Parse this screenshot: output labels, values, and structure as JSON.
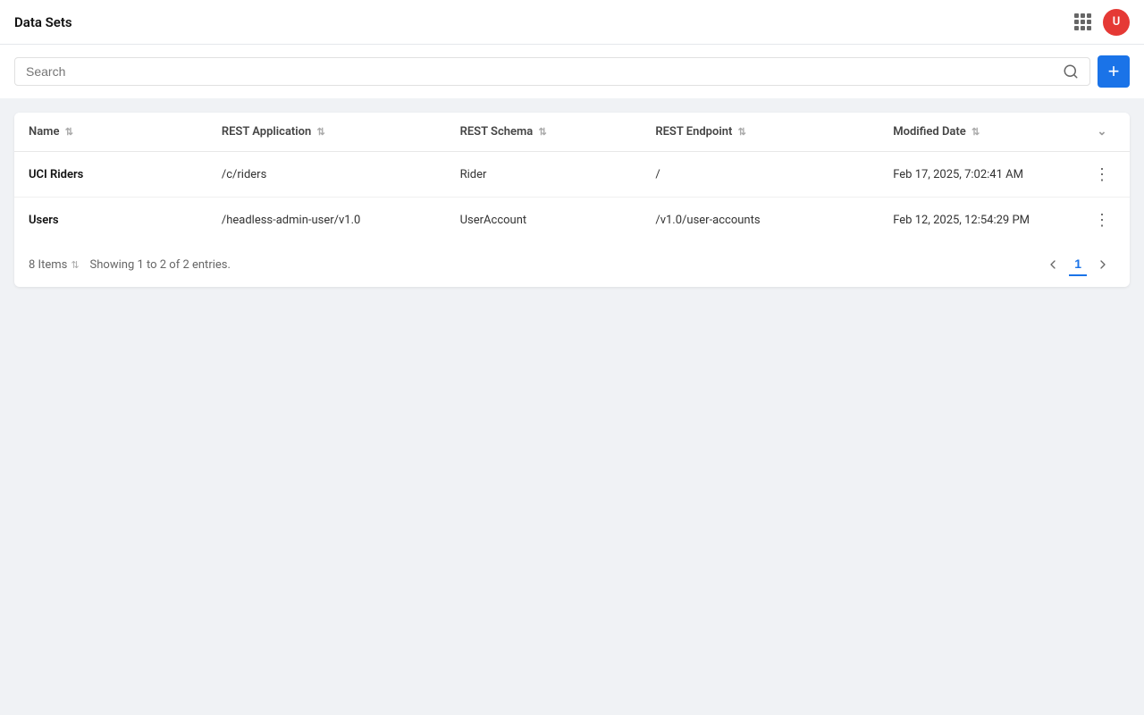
{
  "topBar": {
    "title": "Data Sets",
    "gridIconLabel": "apps-grid",
    "avatarInitial": "U"
  },
  "search": {
    "placeholder": "Search"
  },
  "addButton": {
    "label": "+"
  },
  "table": {
    "columns": [
      {
        "id": "name",
        "label": "Name"
      },
      {
        "id": "rest_application",
        "label": "REST Application"
      },
      {
        "id": "rest_schema",
        "label": "REST Schema"
      },
      {
        "id": "rest_endpoint",
        "label": "REST Endpoint"
      },
      {
        "id": "modified_date",
        "label": "Modified Date"
      }
    ],
    "rows": [
      {
        "name": "UCI Riders",
        "rest_application": "/c/riders",
        "rest_schema": "Rider",
        "rest_endpoint": "/",
        "modified_date": "Feb 17, 2025, 7:02:41 AM"
      },
      {
        "name": "Users",
        "rest_application": "/headless-admin-user/v1.0",
        "rest_schema": "UserAccount",
        "rest_endpoint": "/v1.0/user-accounts",
        "modified_date": "Feb 12, 2025, 12:54:29 PM"
      }
    ]
  },
  "footer": {
    "itemsCount": "8 Items",
    "showingText": "Showing 1 to 2 of 2 entries.",
    "currentPage": "1"
  }
}
